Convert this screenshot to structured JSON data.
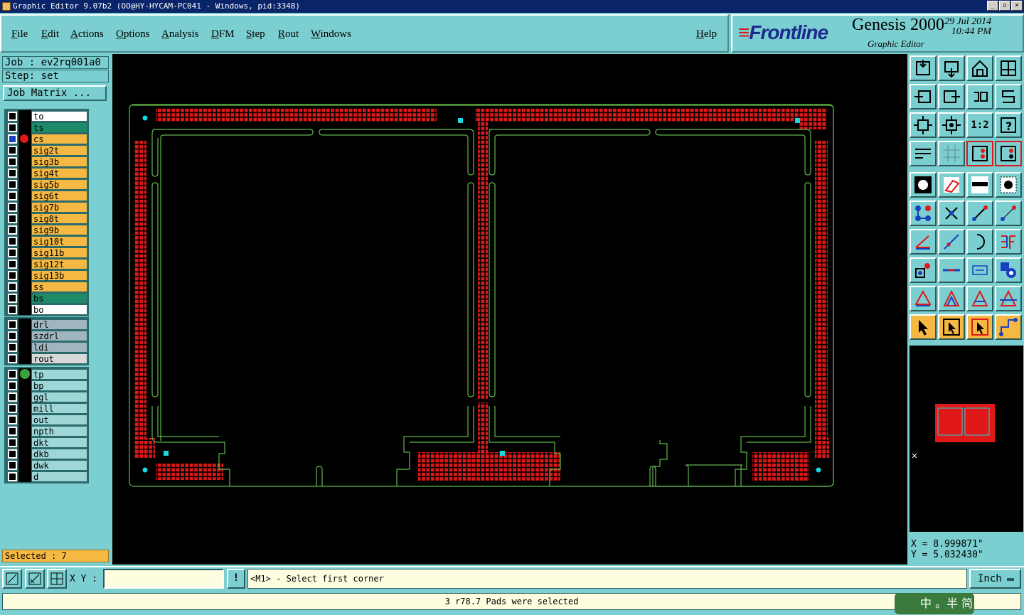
{
  "window": {
    "title": "Graphic Editor 9.07b2  (OO@HY-HYCAM-PC041 - Windows, pid:3348)",
    "btn_min": "_",
    "btn_restore": "▫",
    "btn_close": "×"
  },
  "menu": {
    "items": [
      "File",
      "Edit",
      "Actions",
      "Options",
      "Analysis",
      "DFM",
      "Step",
      "Rout",
      "Windows"
    ],
    "help": "Help"
  },
  "brand": {
    "logo": "Frontline",
    "product": "Genesis 2000",
    "subtitle": "Graphic Editor",
    "date": "29 Jul 2014",
    "time": "10:44 PM"
  },
  "job": {
    "job_label": "Job : ev2rq001a0",
    "step_label": "Step: set",
    "matrix_button": "Job Matrix ..."
  },
  "layers": {
    "board": [
      {
        "name": "to",
        "color": "#ffffff"
      },
      {
        "name": "ts",
        "color": "#1f8a6a"
      },
      {
        "name": "cs",
        "color": "#f5b842"
      },
      {
        "name": "sig2t",
        "color": "#f5b842"
      },
      {
        "name": "sig3b",
        "color": "#f5b842"
      },
      {
        "name": "sig4t",
        "color": "#f5b842"
      },
      {
        "name": "sig5b",
        "color": "#f5b842"
      },
      {
        "name": "sig6t",
        "color": "#f5b842"
      },
      {
        "name": "sig7b",
        "color": "#f5b842"
      },
      {
        "name": "sig8t",
        "color": "#f5b842"
      },
      {
        "name": "sig9b",
        "color": "#f5b842"
      },
      {
        "name": "sig10t",
        "color": "#f5b842"
      },
      {
        "name": "sig11b",
        "color": "#f5b842"
      },
      {
        "name": "sig12t",
        "color": "#f5b842"
      },
      {
        "name": "sig13b",
        "color": "#f5b842"
      },
      {
        "name": "ss",
        "color": "#f5b842"
      },
      {
        "name": "bs",
        "color": "#1f8a6a"
      },
      {
        "name": "bo",
        "color": "#ffffff"
      }
    ],
    "drill": [
      {
        "name": "drl",
        "color": "#9fb6c0"
      },
      {
        "name": "szdrl",
        "color": "#9fb6c0"
      },
      {
        "name": "ldi",
        "color": "#9fb6c0"
      },
      {
        "name": "rout",
        "color": "#d8d8d8"
      }
    ],
    "misc": [
      {
        "name": "tp",
        "color": "#9fd6d8"
      },
      {
        "name": "bp",
        "color": "#9fd6d8"
      },
      {
        "name": "ggl",
        "color": "#9fd6d8"
      },
      {
        "name": "mill",
        "color": "#9fd6d8"
      },
      {
        "name": "out",
        "color": "#9fd6d8"
      },
      {
        "name": "npth",
        "color": "#9fd6d8"
      },
      {
        "name": "dkt",
        "color": "#9fd6d8"
      },
      {
        "name": "dkb",
        "color": "#9fd6d8"
      },
      {
        "name": "dwk",
        "color": "#9fd6d8"
      },
      {
        "name": "d",
        "color": "#9fd6d8"
      }
    ]
  },
  "selected": "Selected : 7",
  "coords": {
    "x": "X = 8.999871\"",
    "y": "Y = 5.032430\""
  },
  "bottom": {
    "xy_label": "X Y :",
    "xy_value": "",
    "info_button": "!",
    "prompt": "<M1> - Select first corner",
    "unit": "Inch"
  },
  "status": "3 r78.7 Pads were selected",
  "ime": "中 。半 简",
  "zoom_label": "1:2"
}
